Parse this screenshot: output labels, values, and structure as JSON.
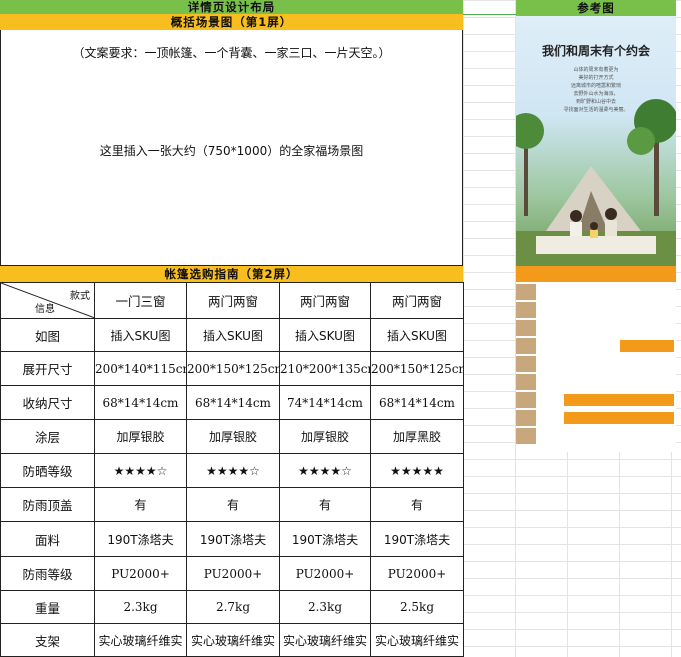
{
  "header": {
    "main_title": "详情页设计布局",
    "ref_title": "参考图"
  },
  "section1": {
    "title": "概括场景图（第1屏）",
    "requirement": "（文案要求：一顶帐篷、一个背囊、一家三口、一片天空。）",
    "image_note": "这里插入一张大约（750*1000）的全家福场景图"
  },
  "section2": {
    "title": "帐篷选购指南（第2屏）",
    "corner_top": "款式",
    "corner_bottom": "信息",
    "columns": [
      "一门三窗",
      "两门两窗",
      "两门两窗",
      "两门两窗"
    ],
    "rows": [
      {
        "label": "如图",
        "values": [
          "插入SKU图",
          "插入SKU图",
          "插入SKU图",
          "插入SKU图"
        ]
      },
      {
        "label": "展开尺寸",
        "values": [
          "200*140*115cm",
          "200*150*125cm",
          "210*200*135cm",
          "200*150*125cm"
        ]
      },
      {
        "label": "收纳尺寸",
        "values": [
          "68*14*14cm",
          "68*14*14cm",
          "74*14*14cm",
          "68*14*14cm"
        ]
      },
      {
        "label": "涂层",
        "values": [
          "加厚银胶",
          "加厚银胶",
          "加厚银胶",
          "加厚黑胶"
        ]
      },
      {
        "label": "防晒等级",
        "values": [
          "★★★★☆",
          "★★★★☆",
          "★★★★☆",
          "★★★★★"
        ]
      },
      {
        "label": "防雨顶盖",
        "values": [
          "有",
          "有",
          "有",
          "有"
        ]
      },
      {
        "label": "面料",
        "values": [
          "190T涤塔夫",
          "190T涤塔夫",
          "190T涤塔夫",
          "190T涤塔夫"
        ]
      },
      {
        "label": "防雨等级",
        "values": [
          "PU2000+",
          "PU2000+",
          "PU2000+",
          "PU2000+"
        ]
      },
      {
        "label": "重量",
        "values": [
          "2.3kg",
          "2.7kg",
          "2.3kg",
          "2.5kg"
        ]
      },
      {
        "label": "支架",
        "values": [
          "实心玻璃纤维实",
          "实心玻璃纤维实",
          "实心玻璃纤维实",
          "实心玻璃纤维实"
        ]
      }
    ]
  },
  "reference": {
    "headline": "我们和周末有个约会",
    "sub_lines": [
      "山体的周末有着更为",
      "美好的打开方式",
      "远离城市的喧嚣和繁琐",
      "去野外山水为海派，",
      "到旷野和山谷中去",
      "寻找面对生活的温柔与美丽。"
    ],
    "colors": {
      "accent": "#f39a1a",
      "label_col": "#c9a77d"
    }
  }
}
